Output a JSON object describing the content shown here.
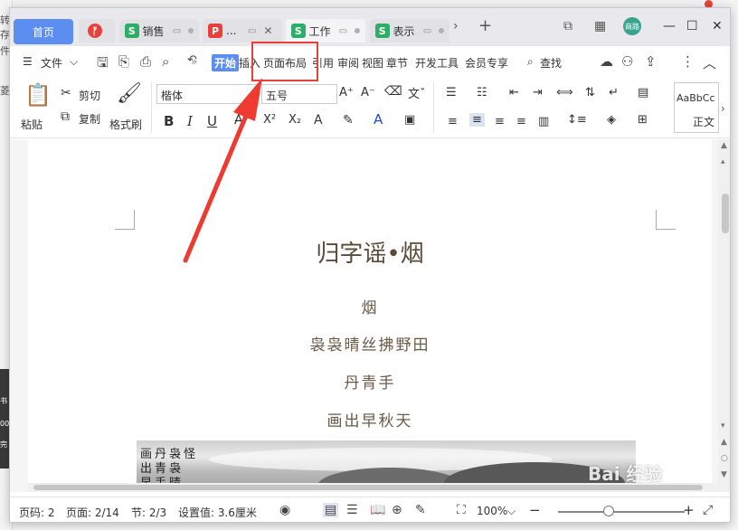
{
  "background": {
    "left_texts": [
      "转存",
      "件",
      "菱"
    ],
    "left_bottom_texts": [
      "书",
      "00",
      "完"
    ]
  },
  "tabs": [
    {
      "label": "首页",
      "type": "home"
    },
    {
      "label": "",
      "icon": "wps-logo",
      "color": "#e8413b"
    },
    {
      "label": "销售",
      "icon": "S",
      "color": "#2cae66"
    },
    {
      "label": "...",
      "icon": "P",
      "color": "#e8413b"
    },
    {
      "label": "工作",
      "icon": "S",
      "color": "#2cae66"
    },
    {
      "label": "表示",
      "icon": "S",
      "color": "#2cae66"
    }
  ],
  "titlebar": {
    "avatar_text": "商路",
    "add_tab": "+",
    "more_tabs": "›"
  },
  "menu": {
    "file": "文件",
    "more": "»",
    "items": [
      "开始",
      "插入",
      "页面布局",
      "引用",
      "审阅",
      "视图",
      "章节",
      "开发工具",
      "会员专享"
    ],
    "search": "查找"
  },
  "ribbon": {
    "paste": "粘贴",
    "cut": "剪切",
    "copy": "复制",
    "format_painter": "格式刷",
    "font_name": "楷体",
    "font_size": "五号",
    "bold": "B",
    "italic": "I",
    "underline": "U",
    "superscript": "X²",
    "subscript": "X₂",
    "style_preview": "AaBbCc",
    "style_name": "正文"
  },
  "document": {
    "title": "归字谣•烟",
    "lines": [
      "烟",
      "袅袅晴丝拂野田",
      "丹青手",
      "画出早秋天"
    ],
    "painting_text": [
      "画丹袅怪",
      "出青袅",
      "早手晴"
    ]
  },
  "status": {
    "page_code": "页码: 2",
    "page": "页面: 2/14",
    "section": "节: 2/3",
    "setting": "设置值: 3.6厘米",
    "zoom": "100%",
    "zoom_minus": "−",
    "zoom_plus": "+"
  },
  "watermark": "Bai 经验",
  "colors": {
    "accent": "#5b8ef0",
    "annotation": "#e8413b",
    "wps_green": "#2cae66"
  }
}
